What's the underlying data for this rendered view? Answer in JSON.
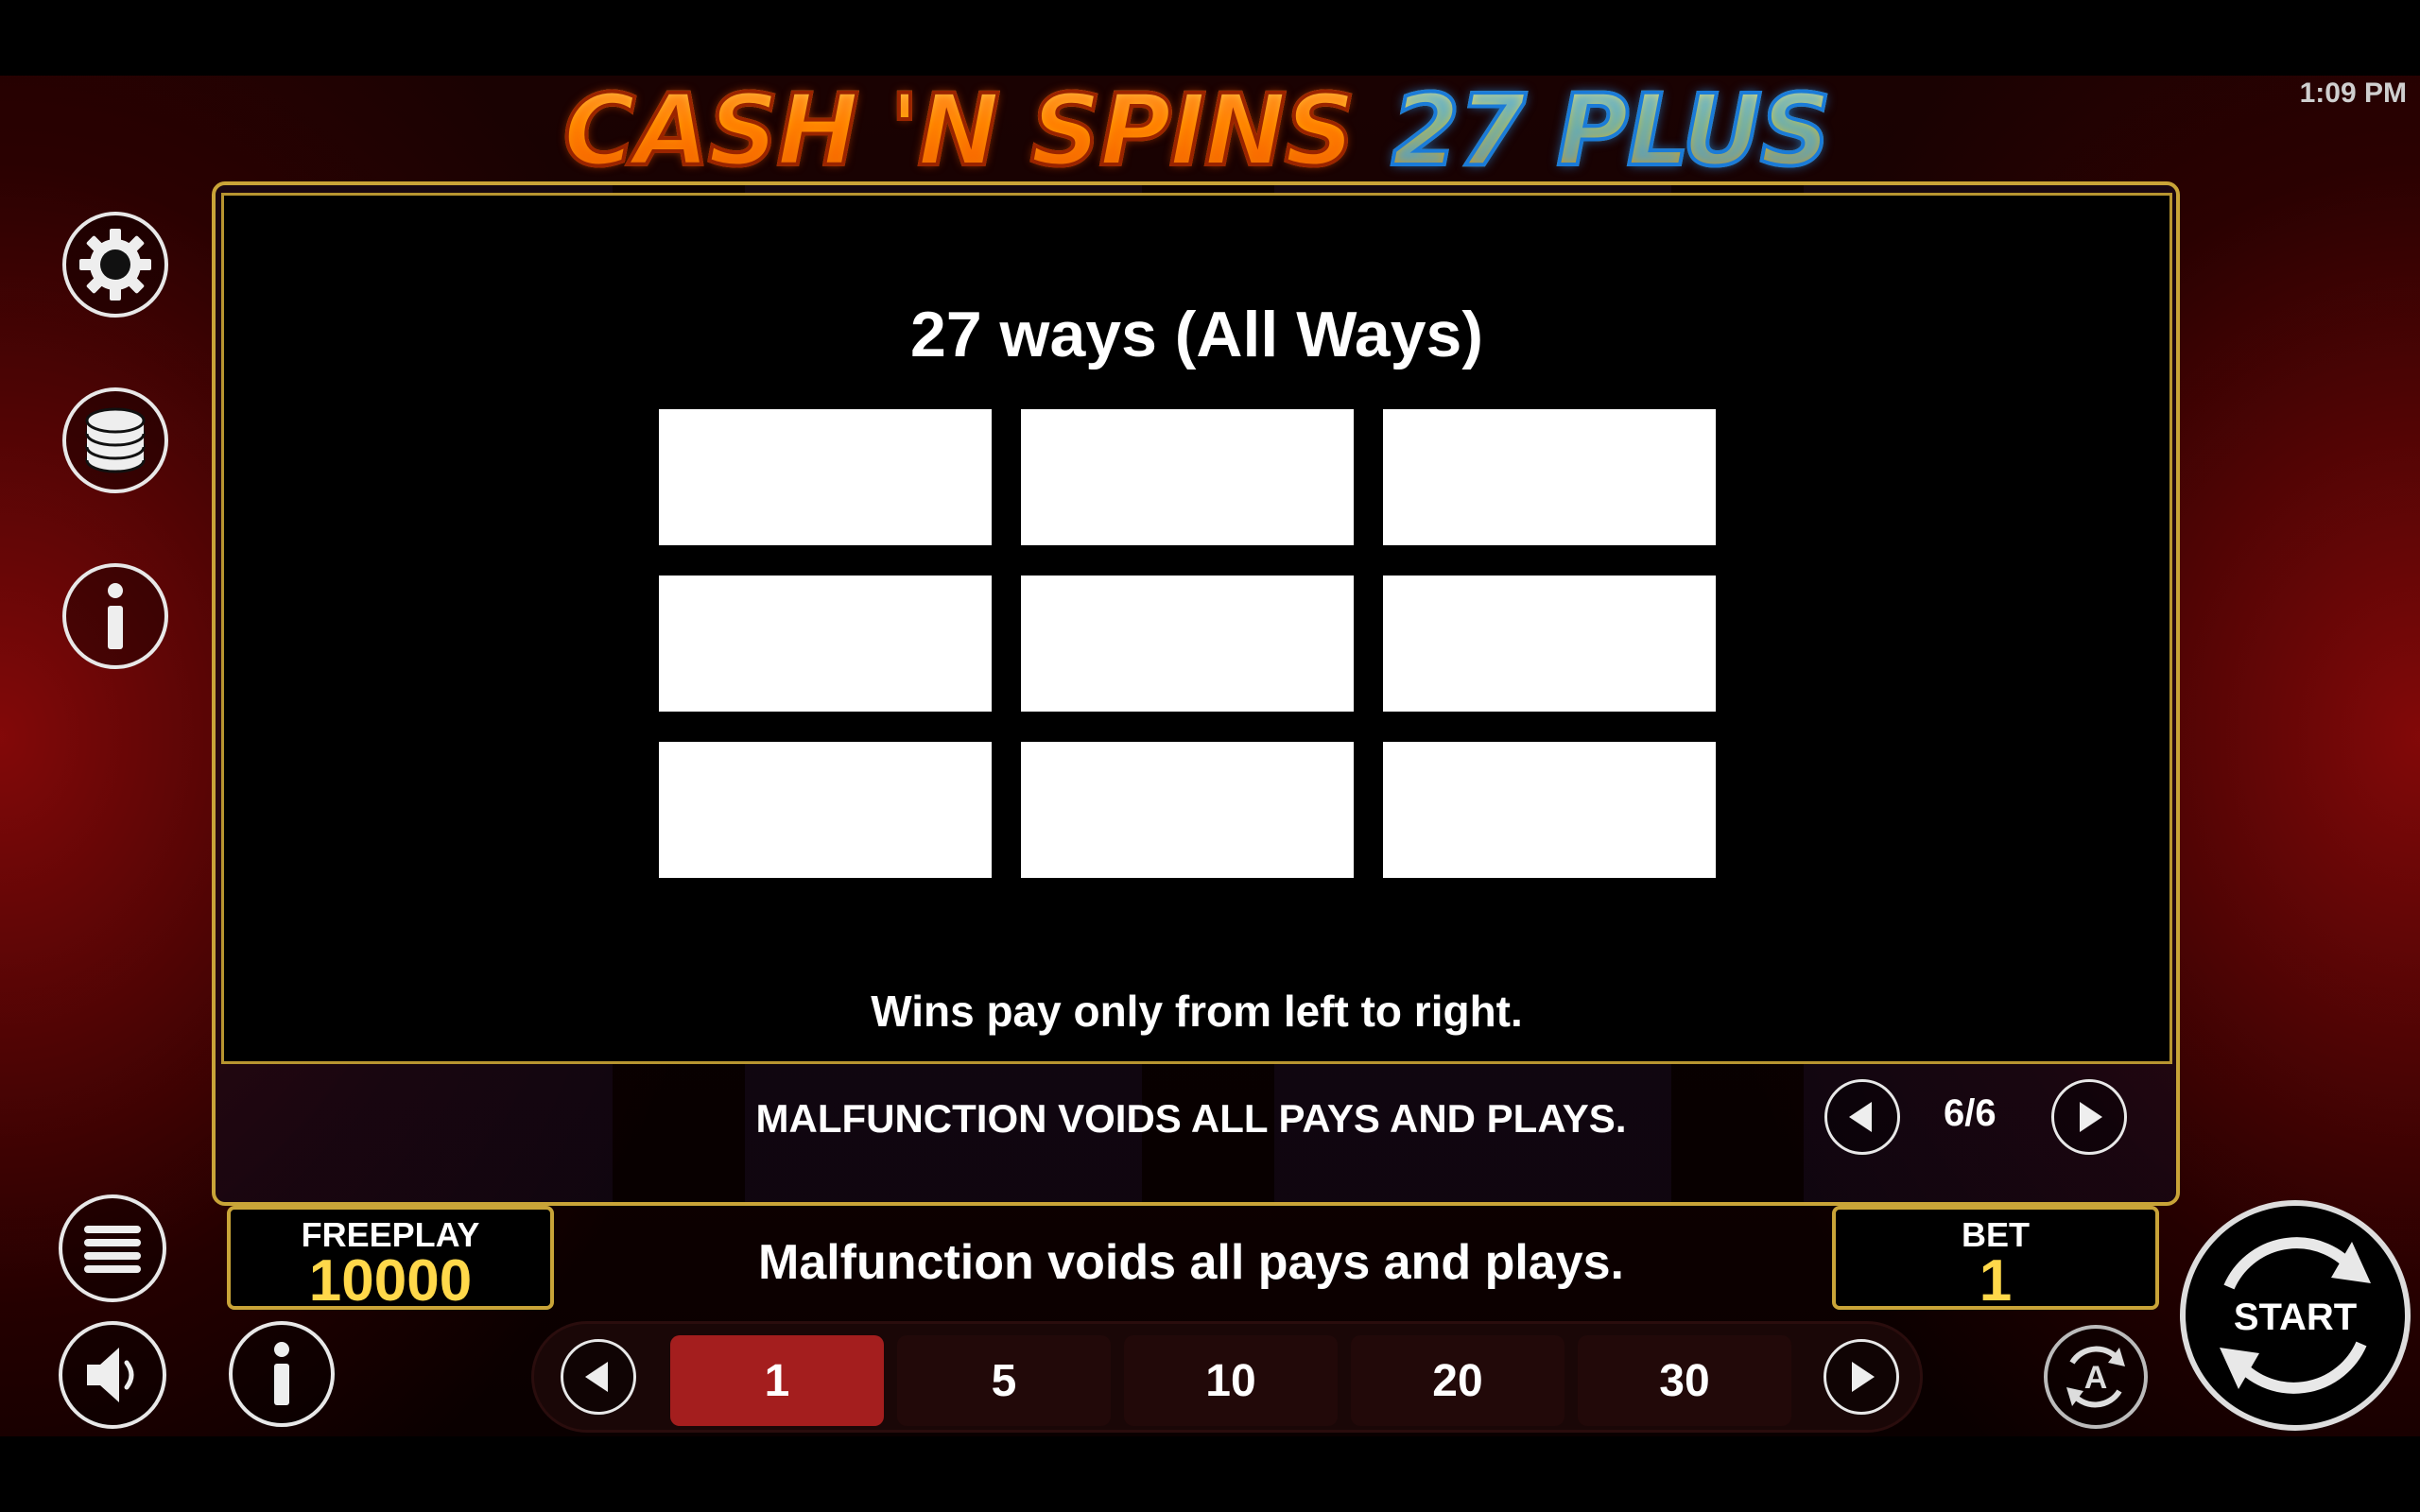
{
  "header": {
    "logo_part1": "CASH 'N SPINS",
    "logo_part2": "27 PLUS",
    "clock": "1:09 PM"
  },
  "sidebar": {
    "icons": [
      "gear-icon",
      "coins-stack-icon",
      "info-icon"
    ]
  },
  "panel": {
    "title": "27 ways (All Ways)",
    "grid_rows": 3,
    "grid_cols": 3,
    "note": "Wins pay only from left to right.",
    "malfunction": "MALFUNCTION VOIDS ALL PAYS AND PLAYS.",
    "page_indicator": "6/6"
  },
  "bottom": {
    "freeplay_label": "FREEPLAY",
    "freeplay_value": "10000",
    "malfunction": "Malfunction voids all pays and plays.",
    "bet_label": "BET",
    "bet_value": "1",
    "bet_options": [
      "1",
      "5",
      "10",
      "20",
      "30"
    ],
    "selected_bet": "1",
    "start_label": "START"
  },
  "colors": {
    "gold_border": "#c9a438",
    "selected_bet": "#a41e1e",
    "value_yellow": "#ffd84a"
  }
}
